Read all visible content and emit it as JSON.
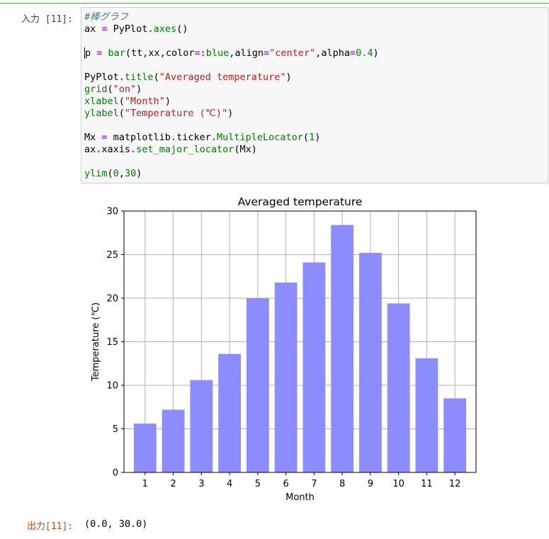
{
  "cell": {
    "input_prompt": "入力 [11]:",
    "output_prompt": "出力[11]:",
    "output_text": "(0.0, 30.0)",
    "code": {
      "l1": "#棒グラフ",
      "l2_a": "ax ",
      "l2_eq": "=",
      "l2_b": " PyPlot",
      "l2_dot": ".",
      "l2_c": "axes",
      "l2_d": "()",
      "l4_a": "p",
      "l4_eq": " =",
      "l4_b": " bar",
      "l4_c": "(tt,xx,color",
      "l4_eq2": "=:",
      "l4_d": "blue",
      "l4_e": ",align",
      "l4_eq3": "=",
      "l4_f": "\"center\"",
      "l4_g": ",alpha",
      "l4_eq4": "=",
      "l4_h": "0.4",
      "l4_i": ")",
      "l6_a": "PyPlot",
      "l6_dot": ".",
      "l6_b": "title",
      "l6_c": "(",
      "l6_d": "\"Averaged temperature\"",
      "l6_e": ")",
      "l7_a": "grid",
      "l7_b": "(",
      "l7_c": "\"on\"",
      "l7_d": ")",
      "l8_a": "xlabel",
      "l8_b": "(",
      "l8_c": "\"Month\"",
      "l8_d": ")",
      "l9_a": "ylabel",
      "l9_b": "(",
      "l9_c": "\"Temperature (℃)\"",
      "l9_d": ")",
      "l11_a": "Mx ",
      "l11_eq": "=",
      "l11_b": " matplotlib",
      "l11_dot1": ".",
      "l11_c": "ticker",
      "l11_dot2": ".",
      "l11_d": "MultipleLocator",
      "l11_e": "(",
      "l11_f": "1",
      "l11_g": ")",
      "l12_a": "ax",
      "l12_dot1": ".",
      "l12_b": "xaxis",
      "l12_dot2": ".",
      "l12_c": "set_major_locator",
      "l12_d": "(Mx)",
      "l14_a": "ylim",
      "l14_b": "(",
      "l14_c": "0",
      "l14_d": ",",
      "l14_e": "30",
      "l14_f": ")"
    }
  },
  "chart_data": {
    "type": "bar",
    "title": "Averaged temperature",
    "xlabel": "Month",
    "ylabel": "Temperature (℃)",
    "categories": [
      "1",
      "2",
      "3",
      "4",
      "5",
      "6",
      "7",
      "8",
      "9",
      "10",
      "11",
      "12"
    ],
    "values": [
      5.6,
      7.2,
      10.6,
      13.6,
      20.0,
      21.8,
      24.1,
      28.4,
      25.2,
      19.4,
      13.1,
      8.5
    ],
    "ylim": [
      0,
      30
    ],
    "yticks": [
      0,
      5,
      10,
      15,
      20,
      25,
      30
    ],
    "grid": true,
    "bar_color": "#8c8cff",
    "grid_color": "#b0b0b0"
  }
}
